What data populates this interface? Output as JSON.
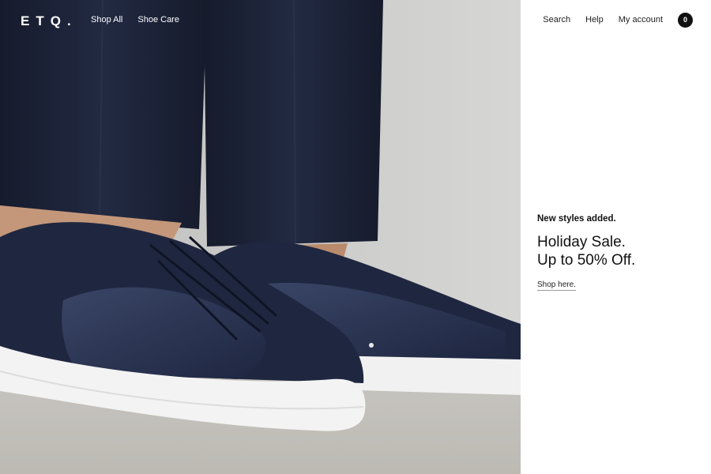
{
  "brand": {
    "logo_text": "ETQ."
  },
  "nav": {
    "left": [
      {
        "label": "Shop All"
      },
      {
        "label": "Shoe Care"
      }
    ],
    "right": [
      {
        "label": "Search"
      },
      {
        "label": "Help"
      },
      {
        "label": "My account"
      }
    ],
    "cart_count": "0"
  },
  "promo": {
    "kicker": "New styles added.",
    "headline_line1": "Holiday Sale.",
    "headline_line2": "Up to 50% Off.",
    "cta": "Shop here."
  },
  "colors": {
    "wall": "#cfcfcd",
    "floor": "#c2c0bb",
    "trousers": "#1c2236",
    "shoe_suede": "#1f2740",
    "shoe_leather": "#2a3350",
    "sole": "#f3f3f3",
    "panel_bg": "#ffffff",
    "text": "#111111"
  }
}
